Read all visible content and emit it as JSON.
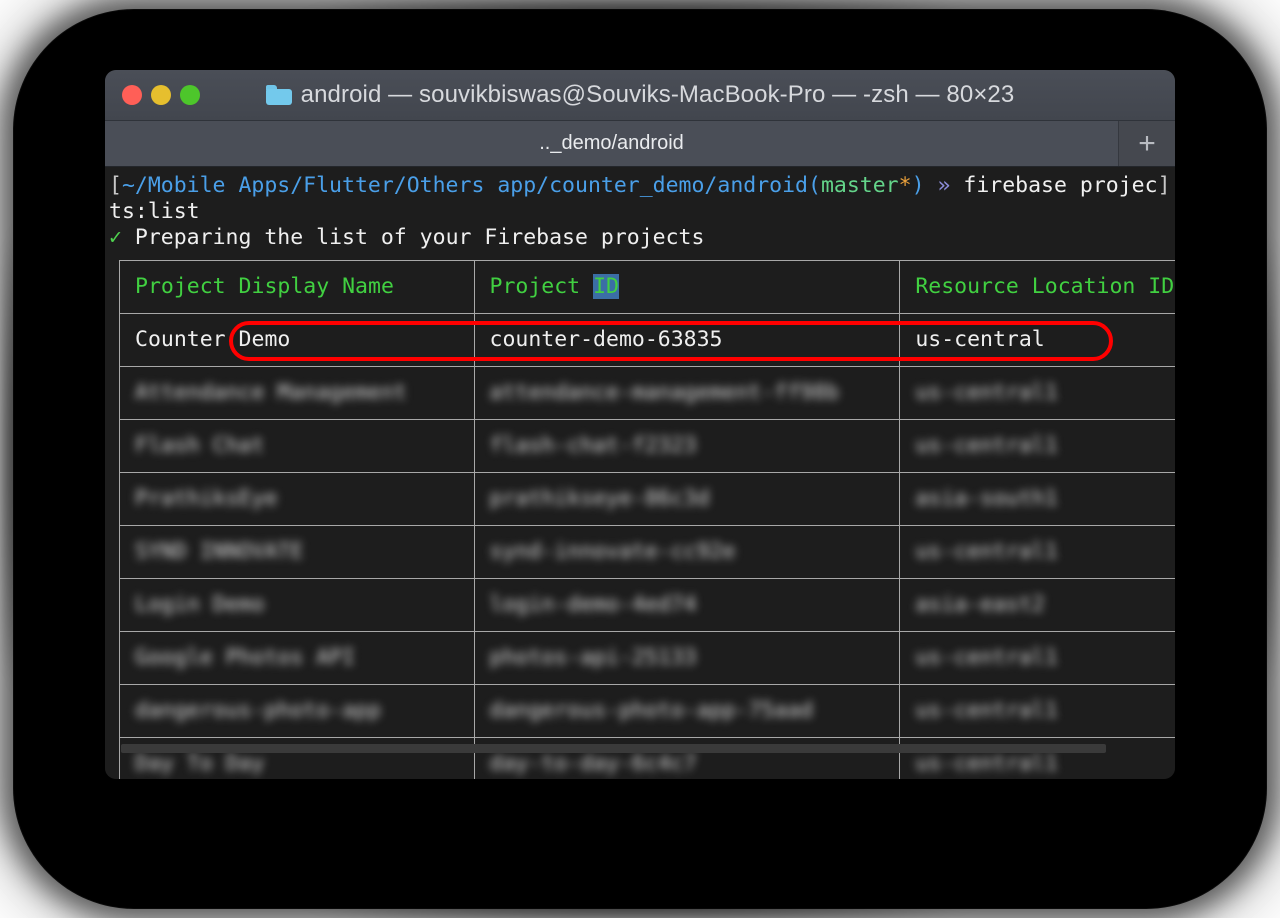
{
  "window": {
    "title": "android — souvikbiswas@Souviks-MacBook-Pro — -zsh — 80×23",
    "folder_icon": "folder-icon",
    "traffic_lights": {
      "close": "close-button",
      "minimize": "minimize-button",
      "zoom": "zoom-button"
    },
    "colors": {
      "close": "#ff5f57",
      "minimize": "#e6bf2e",
      "zoom": "#4dc62b",
      "titlebar": "#45484f",
      "terminal_bg": "#1d1d1d",
      "accent_green": "#41d041",
      "accent_blue": "#4a9fe8",
      "highlight_red": "#ff0000",
      "selection_blue": "#3b6ea5"
    }
  },
  "tabbar": {
    "active_tab_label": ".._demo/android",
    "new_tab_label": "+"
  },
  "terminal": {
    "prompt": {
      "open_bracket": "[",
      "path": "~/Mobile Apps/Flutter/Others app/counter_demo/android",
      "branch_open": "(",
      "branch": "master",
      "branch_dirty": "*",
      "branch_close": ")",
      "arrow": "»",
      "command": "firebase projec",
      "close_bracket": "]",
      "command_wrap": "ts:list"
    },
    "status_line": {
      "check": "✓",
      "text": "Preparing the list of your Firebase projects"
    }
  },
  "table": {
    "headers": {
      "col1": "Project Display Name",
      "col2_prefix": "Project ",
      "col2_selected": "ID",
      "col3": "Resource Location ID"
    },
    "rows": [
      {
        "display_name": "Counter Demo",
        "project_id": "counter-demo-63835",
        "resource_location": "us-central",
        "highlighted": true,
        "blurred": false
      },
      {
        "display_name": "Attendance Management",
        "project_id": "attendance-management-ff98b",
        "resource_location": "us-central1",
        "highlighted": false,
        "blurred": true
      },
      {
        "display_name": "Flash Chat",
        "project_id": "flash-chat-f2323",
        "resource_location": "us-central1",
        "highlighted": false,
        "blurred": true
      },
      {
        "display_name": "PrathiksEye",
        "project_id": "prathikseye-86c3d",
        "resource_location": "asia-south1",
        "highlighted": false,
        "blurred": true
      },
      {
        "display_name": "SYND INNOVATE",
        "project_id": "synd-innovate-cc92e",
        "resource_location": "us-central1",
        "highlighted": false,
        "blurred": true
      },
      {
        "display_name": "Login Demo",
        "project_id": "login-demo-4ed74",
        "resource_location": "asia-east2",
        "highlighted": false,
        "blurred": true
      },
      {
        "display_name": "Google Photos API",
        "project_id": "photos-api-25133",
        "resource_location": "us-central1",
        "highlighted": false,
        "blurred": true
      },
      {
        "display_name": "dangerous-photo-app",
        "project_id": "dangerous-photo-app-75aad",
        "resource_location": "us-central1",
        "highlighted": false,
        "blurred": true
      },
      {
        "display_name": "Day To Day",
        "project_id": "day-to-day-6c4c7",
        "resource_location": "us-central1",
        "highlighted": false,
        "blurred": true
      }
    ]
  }
}
